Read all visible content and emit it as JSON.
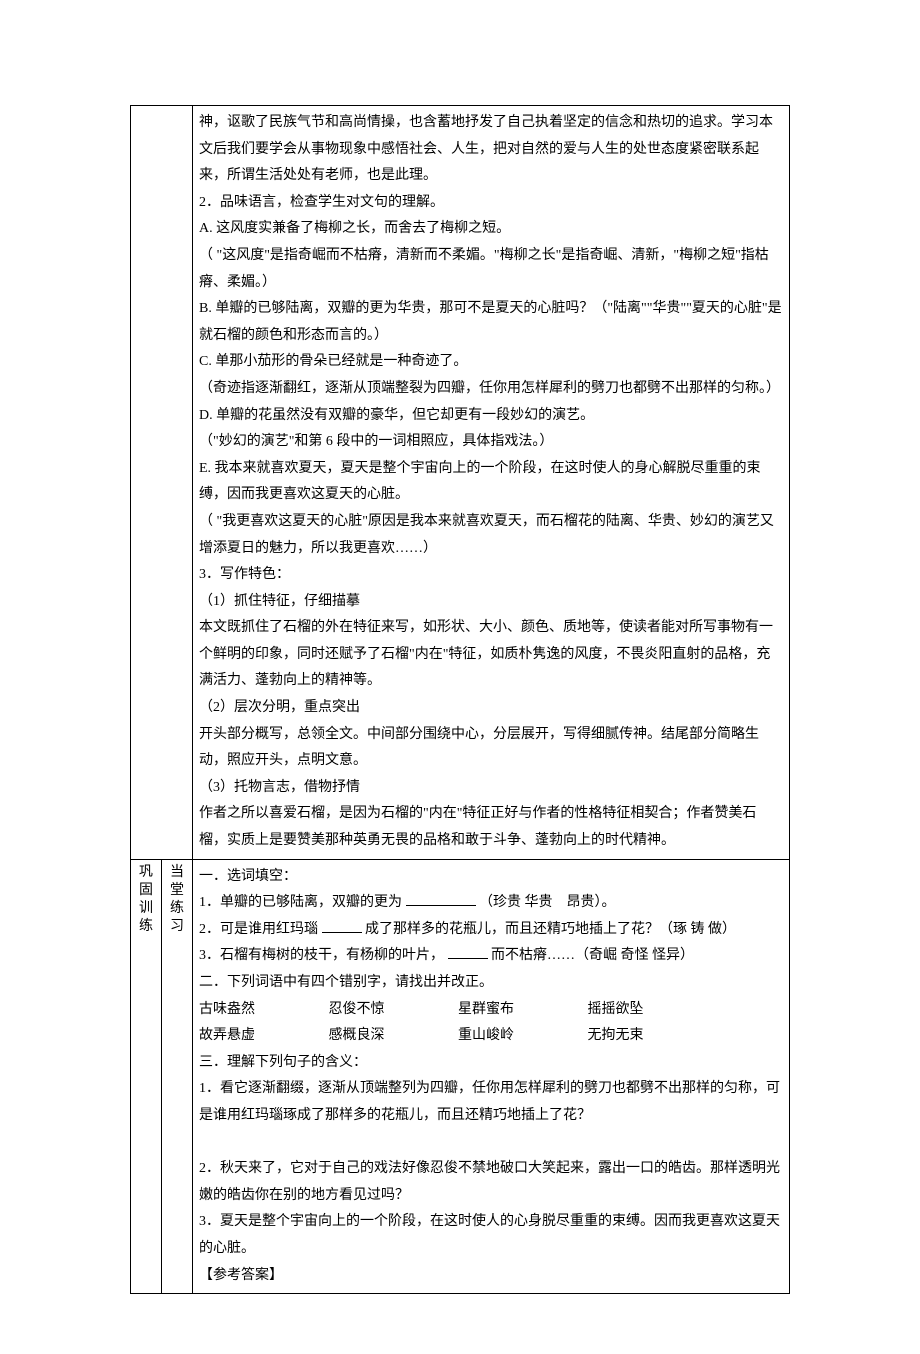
{
  "top": {
    "p1": "神，讴歌了民族气节和高尚情操，也含蓄地抒发了自己执着坚定的信念和热切的追求。学习本文后我们要学会从事物现象中感悟社会、人生，把对自然的爱与人生的处世态度紧密联系起来，所谓生活处处有老师，也是此理。",
    "p2": "2．品味语言，检查学生对文句的理解。",
    "a1": "A. 这风度实兼备了梅柳之长，而舍去了梅柳之短。",
    "a2": "（ \"这风度\"是指奇崛而不枯瘠，清新而不柔媚。\"梅柳之长\"是指奇崛、清新，\"梅柳之短\"指枯瘠、柔媚。）",
    "b1": "B. 单瓣的已够陆离，双瓣的更为华贵，那可不是夏天的心脏吗？（\"陆离\"\"华贵\"\"夏天的心脏\"是就石榴的颜色和形态而言的。）",
    "c1": "C. 单那小茄形的骨朵已经就是一种奇迹了。",
    "c2": "（奇迹指逐渐翻红，逐渐从顶端整裂为四瓣，任你用怎样犀利的劈刀也都劈不出那样的匀称。）",
    "d1": "D. 单瓣的花虽然没有双瓣的豪华，但它却更有一段妙幻的演艺。",
    "d2": "（\"妙幻的演艺\"和第 6 段中的一词相照应，具体指戏法。）",
    "e1": "E. 我本来就喜欢夏天，夏天是整个宇宙向上的一个阶段，在这时使人的身心解脱尽重重的束缚，因而我更喜欢这夏天的心脏。",
    "e2": "（ \"我更喜欢这夏天的心脏\"原因是我本来就喜欢夏天，而石榴花的陆离、华贵、妙幻的演艺又增添夏日的魅力，所以我更喜欢……）",
    "p3": "3．写作特色：",
    "s1t": "（1）抓住特征，仔细描摹",
    "s1b": "本文既抓住了石榴的外在特征来写，如形状、大小、颜色、质地等，使读者能对所写事物有一个鲜明的印象，同时还赋予了石榴\"内在\"特征，如质朴隽逸的风度，不畏炎阳直射的品格，充满活力、蓬勃向上的精神等。",
    "s2t": "（2）层次分明，重点突出",
    "s2b": "开头部分概写，总领全文。中间部分围绕中心，分层展开，写得细腻传神。结尾部分简略生动，照应开头，点明文意。",
    "s3t": "（3）托物言志，借物抒情",
    "s3b": "作者之所以喜爱石榴，是因为石榴的\"内在\"特征正好与作者的性格特征相契合；作者赞美石榴，实质上是要赞美那种英勇无畏的品格和敢于斗争、蓬勃向上的时代精神。"
  },
  "sidebar": {
    "c1": "巩",
    "c2": "固",
    "c3": "训",
    "c4": "练"
  },
  "sidebar2": {
    "c1": "当",
    "c2": "堂",
    "c3": "练",
    "c4": "习"
  },
  "bottom": {
    "sec1_title": "一．选词填空：",
    "sec1_q1a": "1．单瓣的已够陆离，双瓣的更为",
    "sec1_q1b": "（珍贵 华贵　昂贵）。",
    "sec1_q2a": "2．可是谁用红玛瑙",
    "sec1_q2b": "成了那样多的花瓶儿，而且还精巧地插上了花？（琢 铸 做）",
    "sec1_q3a": "3．石榴有梅树的枝干，有杨柳的叶片，",
    "sec1_q3b": "而不枯瘠……（奇崛 奇怪 怪异）",
    "sec2_title": "二．下列词语中有四个错别字，请找出并改正。",
    "w1": "古味盎然",
    "w2": "忍俊不惊",
    "w3": "星群蜜布",
    "w4": "摇摇欲坠",
    "w5": "故弄悬虚",
    "w6": "感概良深",
    "w7": "重山峻岭",
    "w8": "无拘无束",
    "sec3_title": "三．理解下列句子的含义：",
    "sec3_q1": "1．看它逐渐翻缀，逐渐从顶端整列为四瓣，任你用怎样犀利的劈刀也都劈不出那样的匀称，可是谁用红玛瑙琢成了那样多的花瓶儿，而且还精巧地插上了花？",
    "sec3_q2": "2．秋天来了，它对于自己的戏法好像忍俊不禁地破口大笑起来，露出一口的皓齿。那样透明光嫩的皓齿你在别的地方看见过吗？",
    "sec3_q3": "3．夏天是整个宇宙向上的一个阶段，在这时使人的心身脱尽重重的束缚。因而我更喜欢这夏天的心脏。",
    "ans": "【参考答案】"
  }
}
